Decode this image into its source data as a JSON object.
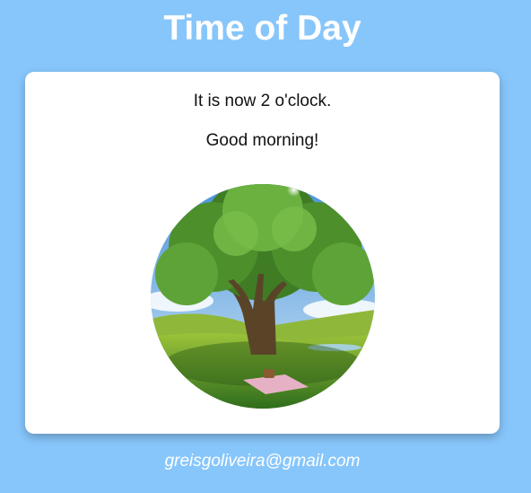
{
  "header": {
    "title": "Time of Day"
  },
  "card": {
    "time_message": "It is now 2 o'clock.",
    "greeting": "Good morning!",
    "image_icon": "tree-picnic-scene"
  },
  "footer": {
    "email": "greisgoliveira@gmail.com"
  },
  "colors": {
    "background": "#87c6fb",
    "card": "#ffffff",
    "title_text": "#ffffff"
  }
}
